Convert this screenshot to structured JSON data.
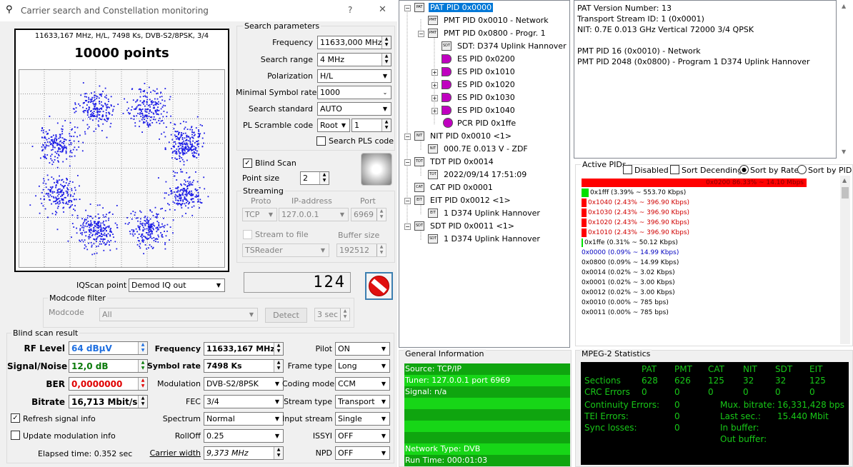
{
  "window": {
    "title": "Carrier search and Constellation monitoring",
    "help": "?",
    "close": "✕"
  },
  "constellation": {
    "info": "11633,167 MHz, H/L, 7498 Ks, DVB-S2/8PSK, 3/4",
    "points": "10000 points"
  },
  "search": {
    "title": "Search parameters",
    "frequency_label": "Frequency",
    "frequency": "11633,000 MHz",
    "range_label": "Search range",
    "range": "4 MHz",
    "pol_label": "Polarization",
    "pol": "H/L",
    "msr_label": "Minimal Symbol rate",
    "msr": "1000",
    "std_label": "Search standard",
    "std": "AUTO",
    "pls_label": "PL Scramble code",
    "pls_mode": "Root",
    "pls_value": "1",
    "search_pls": "Search PLS code"
  },
  "blind": {
    "label": "Blind Scan",
    "point_size_label": "Point size",
    "point_size": "2"
  },
  "streaming": {
    "title": "Streaming",
    "proto_h": "Proto",
    "ip_h": "IP-address",
    "port_h": "Port",
    "proto": "TCP",
    "ip": "127.0.0.1",
    "port": "6969",
    "stream_file": "Stream to file",
    "buffer_h": "Buffer size",
    "reader": "TSReader",
    "buffer": "192512"
  },
  "iq": {
    "label": "IQScan point",
    "value": "Demod IQ out",
    "counter": "124"
  },
  "modcode": {
    "title": "Modcode filter",
    "label": "Modcode",
    "value": "All",
    "detect": "Detect",
    "sec": "3 sec"
  },
  "result": {
    "title": "Blind scan result",
    "rf_label": "RF Level",
    "rf": "64 dBµV",
    "sn_label": "Signal/Noise",
    "sn": "12,0 dB",
    "ber_label": "BER",
    "ber": "0,0000000",
    "br_label": "Bitrate",
    "br": "16,713 Mbit/s",
    "freq_label": "Frequency",
    "freq": "11633,167 MHz",
    "sr_label": "Symbol rate",
    "sr": "7498 Ks",
    "mod_label": "Modulation",
    "mod": "DVB-S2/8PSK",
    "fec_label": "FEC",
    "fec": "3/4",
    "spec_label": "Spectrum",
    "spec": "Normal",
    "roll_label": "RollOff",
    "roll": "0.25",
    "cw_label": "Carrier width",
    "cw": "9,373 MHz",
    "pilot_label": "Pilot",
    "pilot": "ON",
    "frame_label": "Frame type",
    "frame": "Long",
    "coding_label": "Coding mode",
    "coding": "CCM",
    "stype_label": "Stream type",
    "stype": "Transport",
    "input_label": "Input stream",
    "input": "Single",
    "issyi_label": "ISSYI",
    "issyi": "OFF",
    "npd_label": "NPD",
    "npd": "OFF",
    "refresh": "Refresh signal info",
    "update": "Update modulation info",
    "elapsed": "Elapsed time: 0.352 sec"
  },
  "tree": {
    "pat": "PAT PID 0x0000",
    "pmt1": "PMT PID 0x0010 - Network",
    "pmt2": "PMT PID 0x0800 - Progr. 1",
    "sdt1": "SDT: D374 Uplink Hannover",
    "es1": "ES PID 0x0200",
    "es2": "ES PID 0x1010",
    "es3": "ES PID 0x1020",
    "es4": "ES PID 0x1030",
    "es5": "ES PID 0x1040",
    "pcr": "PCR PID 0x1ffe",
    "nit": "NIT PID 0x0010 <1>",
    "nit1": "000.7E 0.013 V - ZDF",
    "tdt": "TDT PID 0x0014",
    "tdt1": "2022/09/14 17:51:09",
    "cat": "CAT PID 0x0001",
    "eit": "EIT PID 0x0012 <1>",
    "eit1": "1 D374 Uplink Hannover",
    "sdt": "SDT PID 0x0011 <1>",
    "sdt2": "1 D374 Uplink Hannover"
  },
  "details": {
    "l1": "PAT Version Number: 13",
    "l2": "Transport Stream ID: 1 (0x0001)",
    "l3": "NIT: 0.7E 0.013 GHz Vertical 72000 3/4 QPSK",
    "l4": "PMT PID 16 (0x0010) - Network",
    "l5": "PMT PID 2048 (0x0800) - Program 1 D374 Uplink Hannover"
  },
  "active": {
    "title": "Active PIDs",
    "disabled": "Disabled",
    "desc": "Sort Decending",
    "rate": "Sort by Rate",
    "pid": "Sort by PID",
    "rows": [
      {
        "text": "0x0200 86.33% ~ 14.10 Mbps",
        "pct": 86.33,
        "color": "#ff0000"
      },
      {
        "text": "0x1fff (3.39% ~ 553.70 Kbps)",
        "pct": 3.39,
        "color": "#00e000"
      },
      {
        "text": "0x1040 (2.43% ~ 396.90 Kbps)",
        "pct": 2.43,
        "color": "#ff0000"
      },
      {
        "text": "0x1030 (2.43% ~ 396.90 Kbps)",
        "pct": 2.43,
        "color": "#ff0000"
      },
      {
        "text": "0x1020 (2.43% ~ 396.90 Kbps)",
        "pct": 2.43,
        "color": "#ff0000"
      },
      {
        "text": "0x1010 (2.43% ~ 396.90 Kbps)",
        "pct": 2.43,
        "color": "#ff0000"
      },
      {
        "text": "0x1ffe (0.31% ~ 50.12 Kbps)",
        "pct": 0.31,
        "color": "#00e000"
      },
      {
        "text": "0x0000 (0.09% ~ 14.99 Kbps)",
        "pct": 0.09,
        "color": "#0000c0"
      },
      {
        "text": "0x0800 (0.09% ~ 14.99 Kbps)",
        "pct": 0.09,
        "color": "#000000"
      },
      {
        "text": "0x0014 (0.02% ~ 3.02 Kbps)",
        "pct": 0.02,
        "color": "#000000"
      },
      {
        "text": "0x0001 (0.02% ~ 3.00 Kbps)",
        "pct": 0.02,
        "color": "#000000"
      },
      {
        "text": "0x0012 (0.02% ~ 3.00 Kbps)",
        "pct": 0.02,
        "color": "#000000"
      },
      {
        "text": "0x0010 (0.00% ~ 785 bps)",
        "pct": 0.0,
        "color": "#000000"
      },
      {
        "text": "0x0011 (0.00% ~ 785 bps)",
        "pct": 0.0,
        "color": "#000000"
      }
    ]
  },
  "general": {
    "title": "General Information",
    "l1": "Source: TCP/IP",
    "l2": "Tuner: 127.0.0.1 port 6969",
    "l3": "Signal: n/a",
    "l4": "Network Type: DVB",
    "l5": "Run Time: 000:01:03"
  },
  "mpeg": {
    "title": "MPEG-2 Statistics",
    "h_pat": "PAT",
    "h_pmt": "PMT",
    "h_cat": "CAT",
    "h_nit": "NIT",
    "h_sdt": "SDT",
    "h_eit": "EIT",
    "sections": "Sections",
    "s_pat": "628",
    "s_pmt": "626",
    "s_cat": "125",
    "s_nit": "32",
    "s_sdt": "32",
    "s_eit": "125",
    "crc": "CRC Errors",
    "c_pat": "0",
    "c_pmt": "0",
    "c_cat": "0",
    "c_nit": "0",
    "c_sdt": "0",
    "c_eit": "0",
    "cont": "Continuity Errors:",
    "cont_v": "0",
    "tei": "TEI Errors:",
    "tei_v": "0",
    "sync": "Sync losses:",
    "sync_v": "0",
    "mux": "Mux. bitrate:",
    "mux_v": "16,331,428 bps",
    "last": "Last sec.:",
    "last_v": "15.440 Mbit",
    "inbuf": "In buffer:",
    "outbuf": "Out buffer:"
  }
}
